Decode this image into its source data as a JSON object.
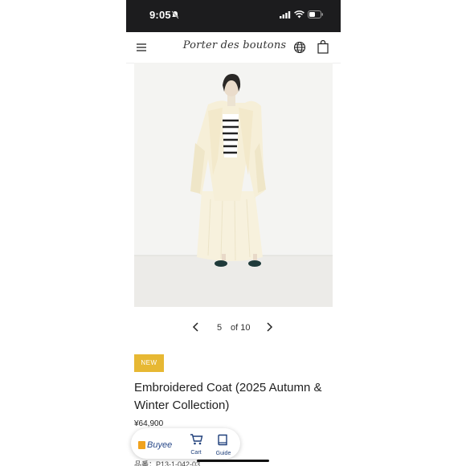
{
  "status_bar": {
    "time": "9:05"
  },
  "header": {
    "logo_text": "Porter des boutons"
  },
  "product": {
    "badge": "NEW",
    "title": "Embroidered Coat (2025 Autumn & Winter Collection)",
    "price": "¥64,900",
    "sku": "品番：P13-1-042-03"
  },
  "pager": {
    "current": "5",
    "total_text": "of 10"
  },
  "buyee": {
    "logo_text": "Buyee",
    "cart_label": "Cart",
    "guide_label": "Guide"
  },
  "colors": {
    "badge": "#e7b833",
    "buyee_blue": "#1e3f7a",
    "coat": "#f6efd8"
  }
}
